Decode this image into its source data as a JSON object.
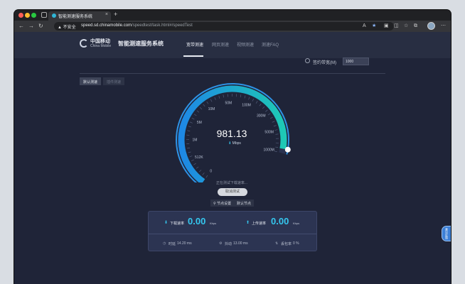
{
  "browser": {
    "tab_title": "智能测速服务系统",
    "tab_close": "×",
    "new_tab": "+",
    "security_label": "不安全",
    "url_host": "speed.sd.chinamobile.com",
    "url_path": "/speedtest/task.html#/speedTest",
    "back": "←",
    "forward": "→",
    "reload": "↻",
    "home": "⌂"
  },
  "site": {
    "logo_cn": "中国移动",
    "logo_en": "China Mobile",
    "system_title": "智能测速服务系统",
    "nav": [
      {
        "label": "宽带测速",
        "active": true
      },
      {
        "label": "网页测速",
        "active": false
      },
      {
        "label": "视频测速",
        "active": false
      },
      {
        "label": "测速FAQ",
        "active": false
      }
    ]
  },
  "contract": {
    "label": "签约带宽(M)",
    "value": "1000"
  },
  "modes": {
    "default_label": "默认测速",
    "custom_label": "插件测速"
  },
  "gauge": {
    "speed": "981.13",
    "unit": "Mbps",
    "ticks": [
      "0",
      "512K",
      "1M",
      "5M",
      "10M",
      "50M",
      "100M",
      "300M",
      "500M",
      "1000M"
    ],
    "fill_fraction": 0.98
  },
  "test": {
    "status": "正在测试下载速率...",
    "cancel_label": "取消测试",
    "node_settings": "节点设置",
    "default_node": "默认节点"
  },
  "results": {
    "download_label": "下载速率",
    "download_value": "0.00",
    "download_unit": "Kbps",
    "upload_label": "上传速率",
    "upload_value": "0.00",
    "upload_unit": "Kbps",
    "latency_label": "时延",
    "latency_value": "14.20 ms",
    "jitter_label": "抖动",
    "jitter_value": "13.00 ms",
    "loss_label": "丢包率",
    "loss_value": "0 %"
  },
  "float_tab": "意见反馈",
  "colors": {
    "accent_cyan": "#35c7ee",
    "gauge_blue": "#1e88e5",
    "gauge_teal": "#1ec9b5",
    "page_bg": "#1f2438"
  }
}
